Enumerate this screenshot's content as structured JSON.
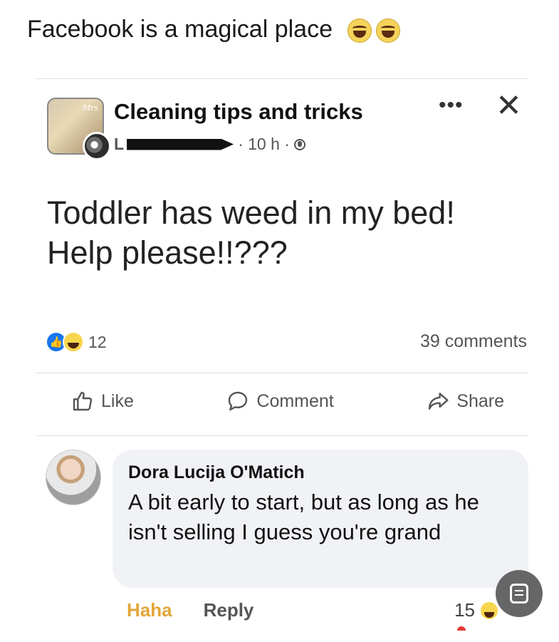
{
  "caption": {
    "text": "Facebook is a magical place",
    "emoji": [
      "laughing-face",
      "laughing-face"
    ]
  },
  "post": {
    "group_name": "Cleaning tips and tricks",
    "author_initial": "L",
    "time": "· 10 h ·",
    "more_label": "•••",
    "close_label": "✕",
    "text": "Toddler has weed in my bed! Help please!!???",
    "reaction_count": "12",
    "comments_count": "39 comments",
    "actions": {
      "like": "Like",
      "comment": "Comment",
      "share": "Share"
    }
  },
  "comment": {
    "author": "Dora Lucija O'Matich",
    "text": "A bit early to start, but as long as he isn't selling I guess you're grand",
    "haha_label": "Haha",
    "reply_label": "Reply",
    "reaction_count": "15"
  },
  "colors": {
    "like_blue": "#1877f2",
    "haha_yellow": "#f7d54c",
    "haha_text": "#e3a63a",
    "bubble_bg": "#f0f2f5"
  }
}
